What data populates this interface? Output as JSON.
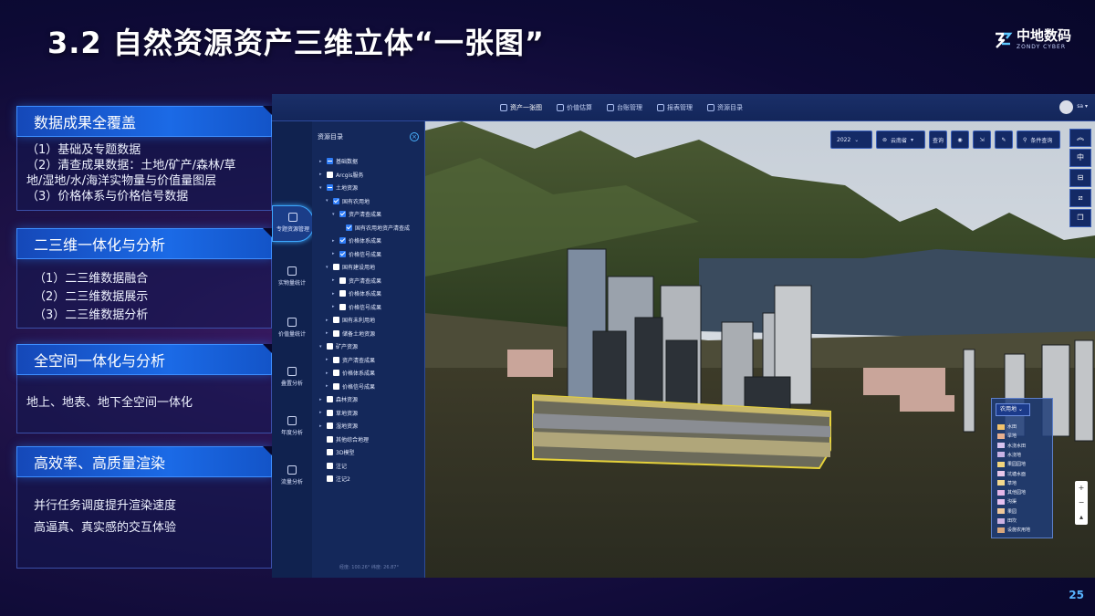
{
  "slide": {
    "title": "3.2 自然资源资产三维立体“一张图”",
    "logo_cn": "中地数码",
    "logo_en": "ZONDY CYBER",
    "page_number": "25"
  },
  "features": [
    {
      "title": "数据成果全覆盖",
      "lines": [
        "（1）基础及专题数据",
        "（2）清查成果数据：土地/矿产/森林/草",
        "地/湿地/水/海洋实物量与价值量图层",
        "（3）价格体系与价格信号数据"
      ]
    },
    {
      "title": "二三维一体化与分析",
      "lines": [
        "（1）二三维数据融合",
        "（2）二三维数据展示",
        "（3）二三维数据分析"
      ]
    },
    {
      "title": "全空间一体化与分析",
      "lines": [
        "地上、地表、地下全空间一体化"
      ]
    },
    {
      "title": "高效率、高质量渲染",
      "lines": [
        "并行任务调度提升渲染速度",
        "高逼真、真实感的交互体验"
      ]
    }
  ],
  "app": {
    "nav": [
      "资产一张图",
      "价值估算",
      "台账管理",
      "报表管理",
      "资源目录"
    ],
    "user": "sa",
    "left_nav": [
      "专题资源管理",
      "实物量统计",
      "价值量统计",
      "叠置分析",
      "年度分析",
      "流量分析"
    ],
    "tree_title": "资源目录",
    "tree_footer": "经度: 100.26°  纬度: 26.87°",
    "tree": [
      {
        "label": "基础数据",
        "depth": 0,
        "arrow": "▸",
        "check": "part"
      },
      {
        "label": "Arcgis服务",
        "depth": 0,
        "arrow": "▸",
        "check": "off"
      },
      {
        "label": "土地资源",
        "depth": 0,
        "arrow": "▾",
        "check": "part"
      },
      {
        "label": "国有农用地",
        "depth": 1,
        "arrow": "▾",
        "check": "on"
      },
      {
        "label": "资产清查成果",
        "depth": 2,
        "arrow": "▾",
        "check": "on"
      },
      {
        "label": "国有农用地资产清查成",
        "depth": 3,
        "arrow": "",
        "check": "on"
      },
      {
        "label": "价格体系成果",
        "depth": 2,
        "arrow": "▸",
        "check": "on"
      },
      {
        "label": "价格信号成果",
        "depth": 2,
        "arrow": "▸",
        "check": "on"
      },
      {
        "label": "国有建设用地",
        "depth": 1,
        "arrow": "▾",
        "check": "off"
      },
      {
        "label": "资产清查成果",
        "depth": 2,
        "arrow": "▸",
        "check": "off"
      },
      {
        "label": "价格体系成果",
        "depth": 2,
        "arrow": "▸",
        "check": "off"
      },
      {
        "label": "价格信号成果",
        "depth": 2,
        "arrow": "▸",
        "check": "off"
      },
      {
        "label": "国有未利用地",
        "depth": 1,
        "arrow": "▸",
        "check": "off"
      },
      {
        "label": "储备土地资源",
        "depth": 1,
        "arrow": "▸",
        "check": "off"
      },
      {
        "label": "矿产资源",
        "depth": 0,
        "arrow": "▾",
        "check": "off"
      },
      {
        "label": "资产清查成果",
        "depth": 1,
        "arrow": "▸",
        "check": "off"
      },
      {
        "label": "价格体系成果",
        "depth": 1,
        "arrow": "▸",
        "check": "off"
      },
      {
        "label": "价格信号成果",
        "depth": 1,
        "arrow": "▸",
        "check": "off"
      },
      {
        "label": "森林资源",
        "depth": 0,
        "arrow": "▸",
        "check": "off"
      },
      {
        "label": "草地资源",
        "depth": 0,
        "arrow": "▸",
        "check": "off"
      },
      {
        "label": "湿地资源",
        "depth": 0,
        "arrow": "▸",
        "check": "off"
      },
      {
        "label": "其他综合地理",
        "depth": 0,
        "arrow": "",
        "check": "off"
      },
      {
        "label": "3D模型",
        "depth": 0,
        "arrow": "",
        "check": "off"
      },
      {
        "label": "注记",
        "depth": 0,
        "arrow": "",
        "check": "off"
      },
      {
        "label": "注记2",
        "depth": 0,
        "arrow": "",
        "check": "off"
      }
    ],
    "toolbar": {
      "year": "2022",
      "region": "云南省",
      "query": "查询",
      "condition_query": "条件查询"
    },
    "legend": {
      "dropdown": "农用地",
      "items": [
        {
          "label": "水田",
          "color": "#f2c36b"
        },
        {
          "label": "旱地",
          "color": "#e8b08f"
        },
        {
          "label": "水浇水田",
          "color": "#d8c4f0"
        },
        {
          "label": "水浇地",
          "color": "#c9b3e6"
        },
        {
          "label": "果园园地",
          "color": "#f4d67c"
        },
        {
          "label": "坑塘水面",
          "color": "#e9c7ea"
        },
        {
          "label": "草地",
          "color": "#f3d98e"
        },
        {
          "label": "其他园地",
          "color": "#e3b6e8"
        },
        {
          "label": "沟渠",
          "color": "#e6c1f0"
        },
        {
          "label": "果园",
          "color": "#f0c89a"
        },
        {
          "label": "田坎",
          "color": "#cbb2e2"
        },
        {
          "label": "设施农用地",
          "color": "#d9a77c"
        }
      ]
    }
  }
}
